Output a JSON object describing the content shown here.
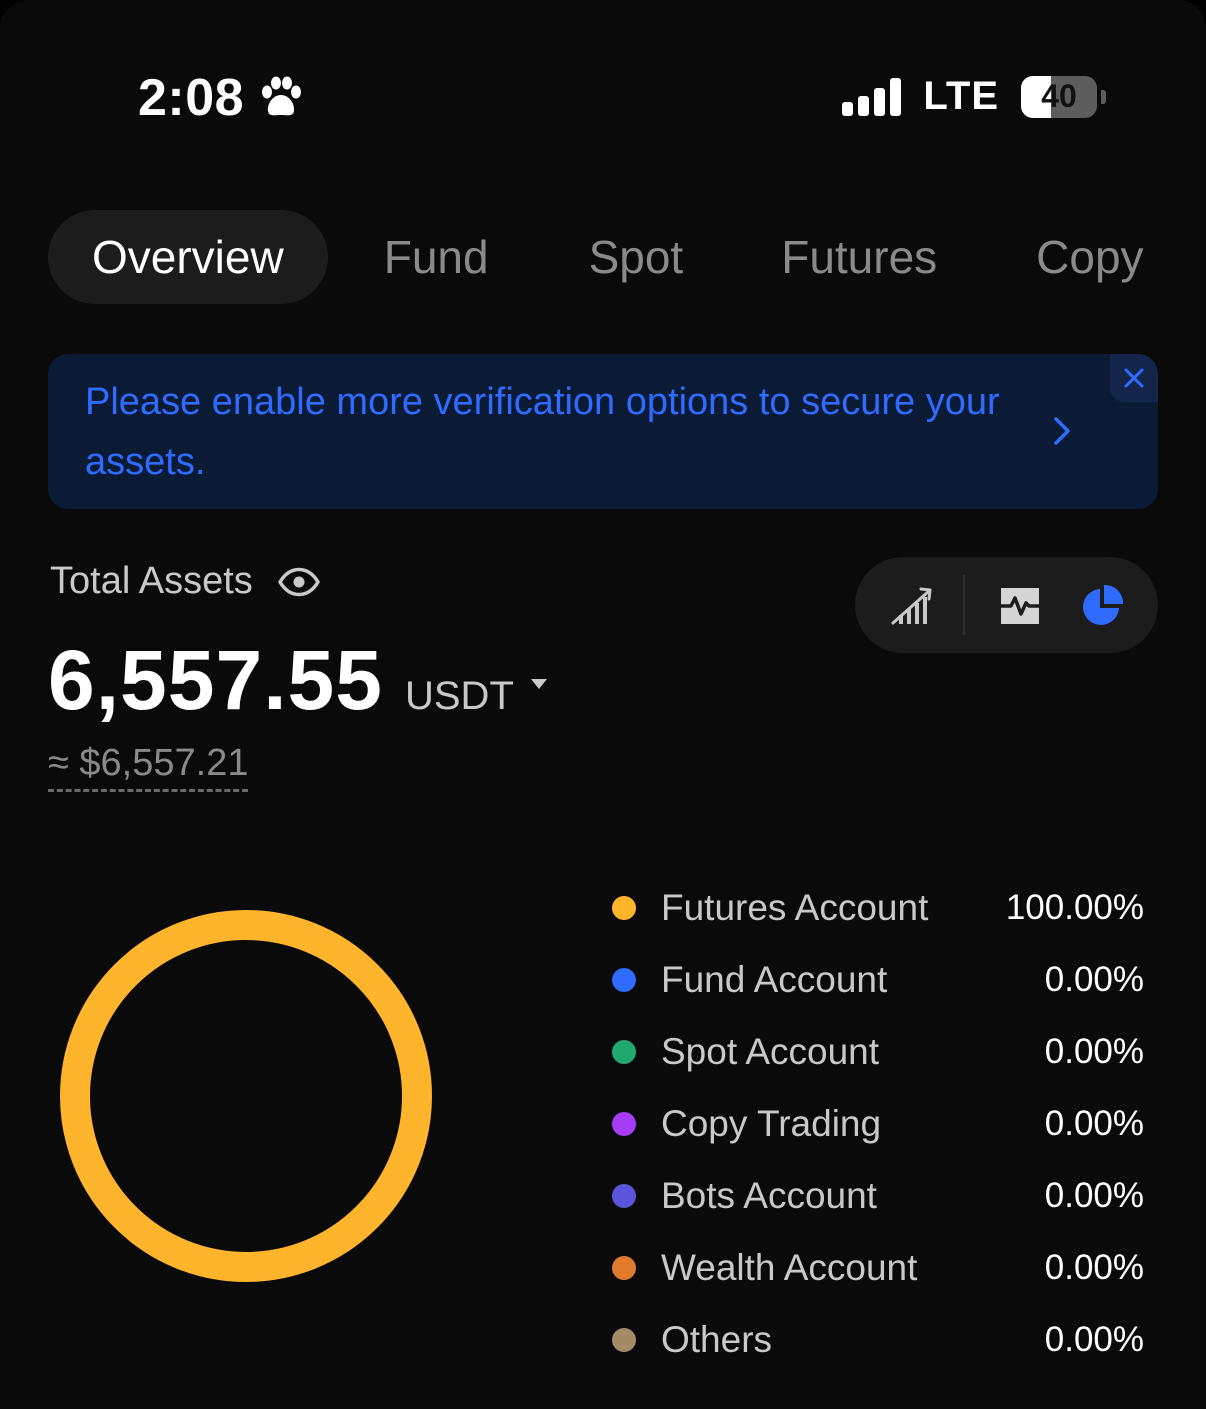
{
  "status_bar": {
    "time": "2:08",
    "network": "LTE",
    "battery": "40",
    "battery_level": 0.4
  },
  "tabs": [
    {
      "label": "Overview",
      "active": true
    },
    {
      "label": "Fund",
      "active": false
    },
    {
      "label": "Spot",
      "active": false
    },
    {
      "label": "Futures",
      "active": false
    },
    {
      "label": "Copy",
      "active": false
    }
  ],
  "banner": {
    "text": "Please enable more verification options to secure your assets."
  },
  "assets": {
    "label": "Total Assets",
    "amount": "6,557.55",
    "currency": "USDT",
    "approx": "≈ $6,557.21"
  },
  "colors": {
    "accent_blue": "#2f6bff",
    "futures": "#ffb52b",
    "fund": "#2f6bff",
    "spot": "#1fa872",
    "copy": "#a63cf5",
    "bots": "#5a55d8",
    "wealth": "#e07a2c",
    "others": "#a48b68"
  },
  "chart_data": {
    "type": "pie",
    "categories": [
      "Futures Account",
      "Fund Account",
      "Spot Account",
      "Copy Trading",
      "Bots Account",
      "Wealth Account",
      "Others"
    ],
    "values": [
      100.0,
      0.0,
      0.0,
      0.0,
      0.0,
      0.0,
      0.0
    ],
    "labels": [
      "100.00%",
      "0.00%",
      "0.00%",
      "0.00%",
      "0.00%",
      "0.00%",
      "0.00%"
    ],
    "colors": [
      "#ffb52b",
      "#2f6bff",
      "#1fa872",
      "#a63cf5",
      "#5a55d8",
      "#e07a2c",
      "#a48b68"
    ],
    "legend": "right"
  }
}
